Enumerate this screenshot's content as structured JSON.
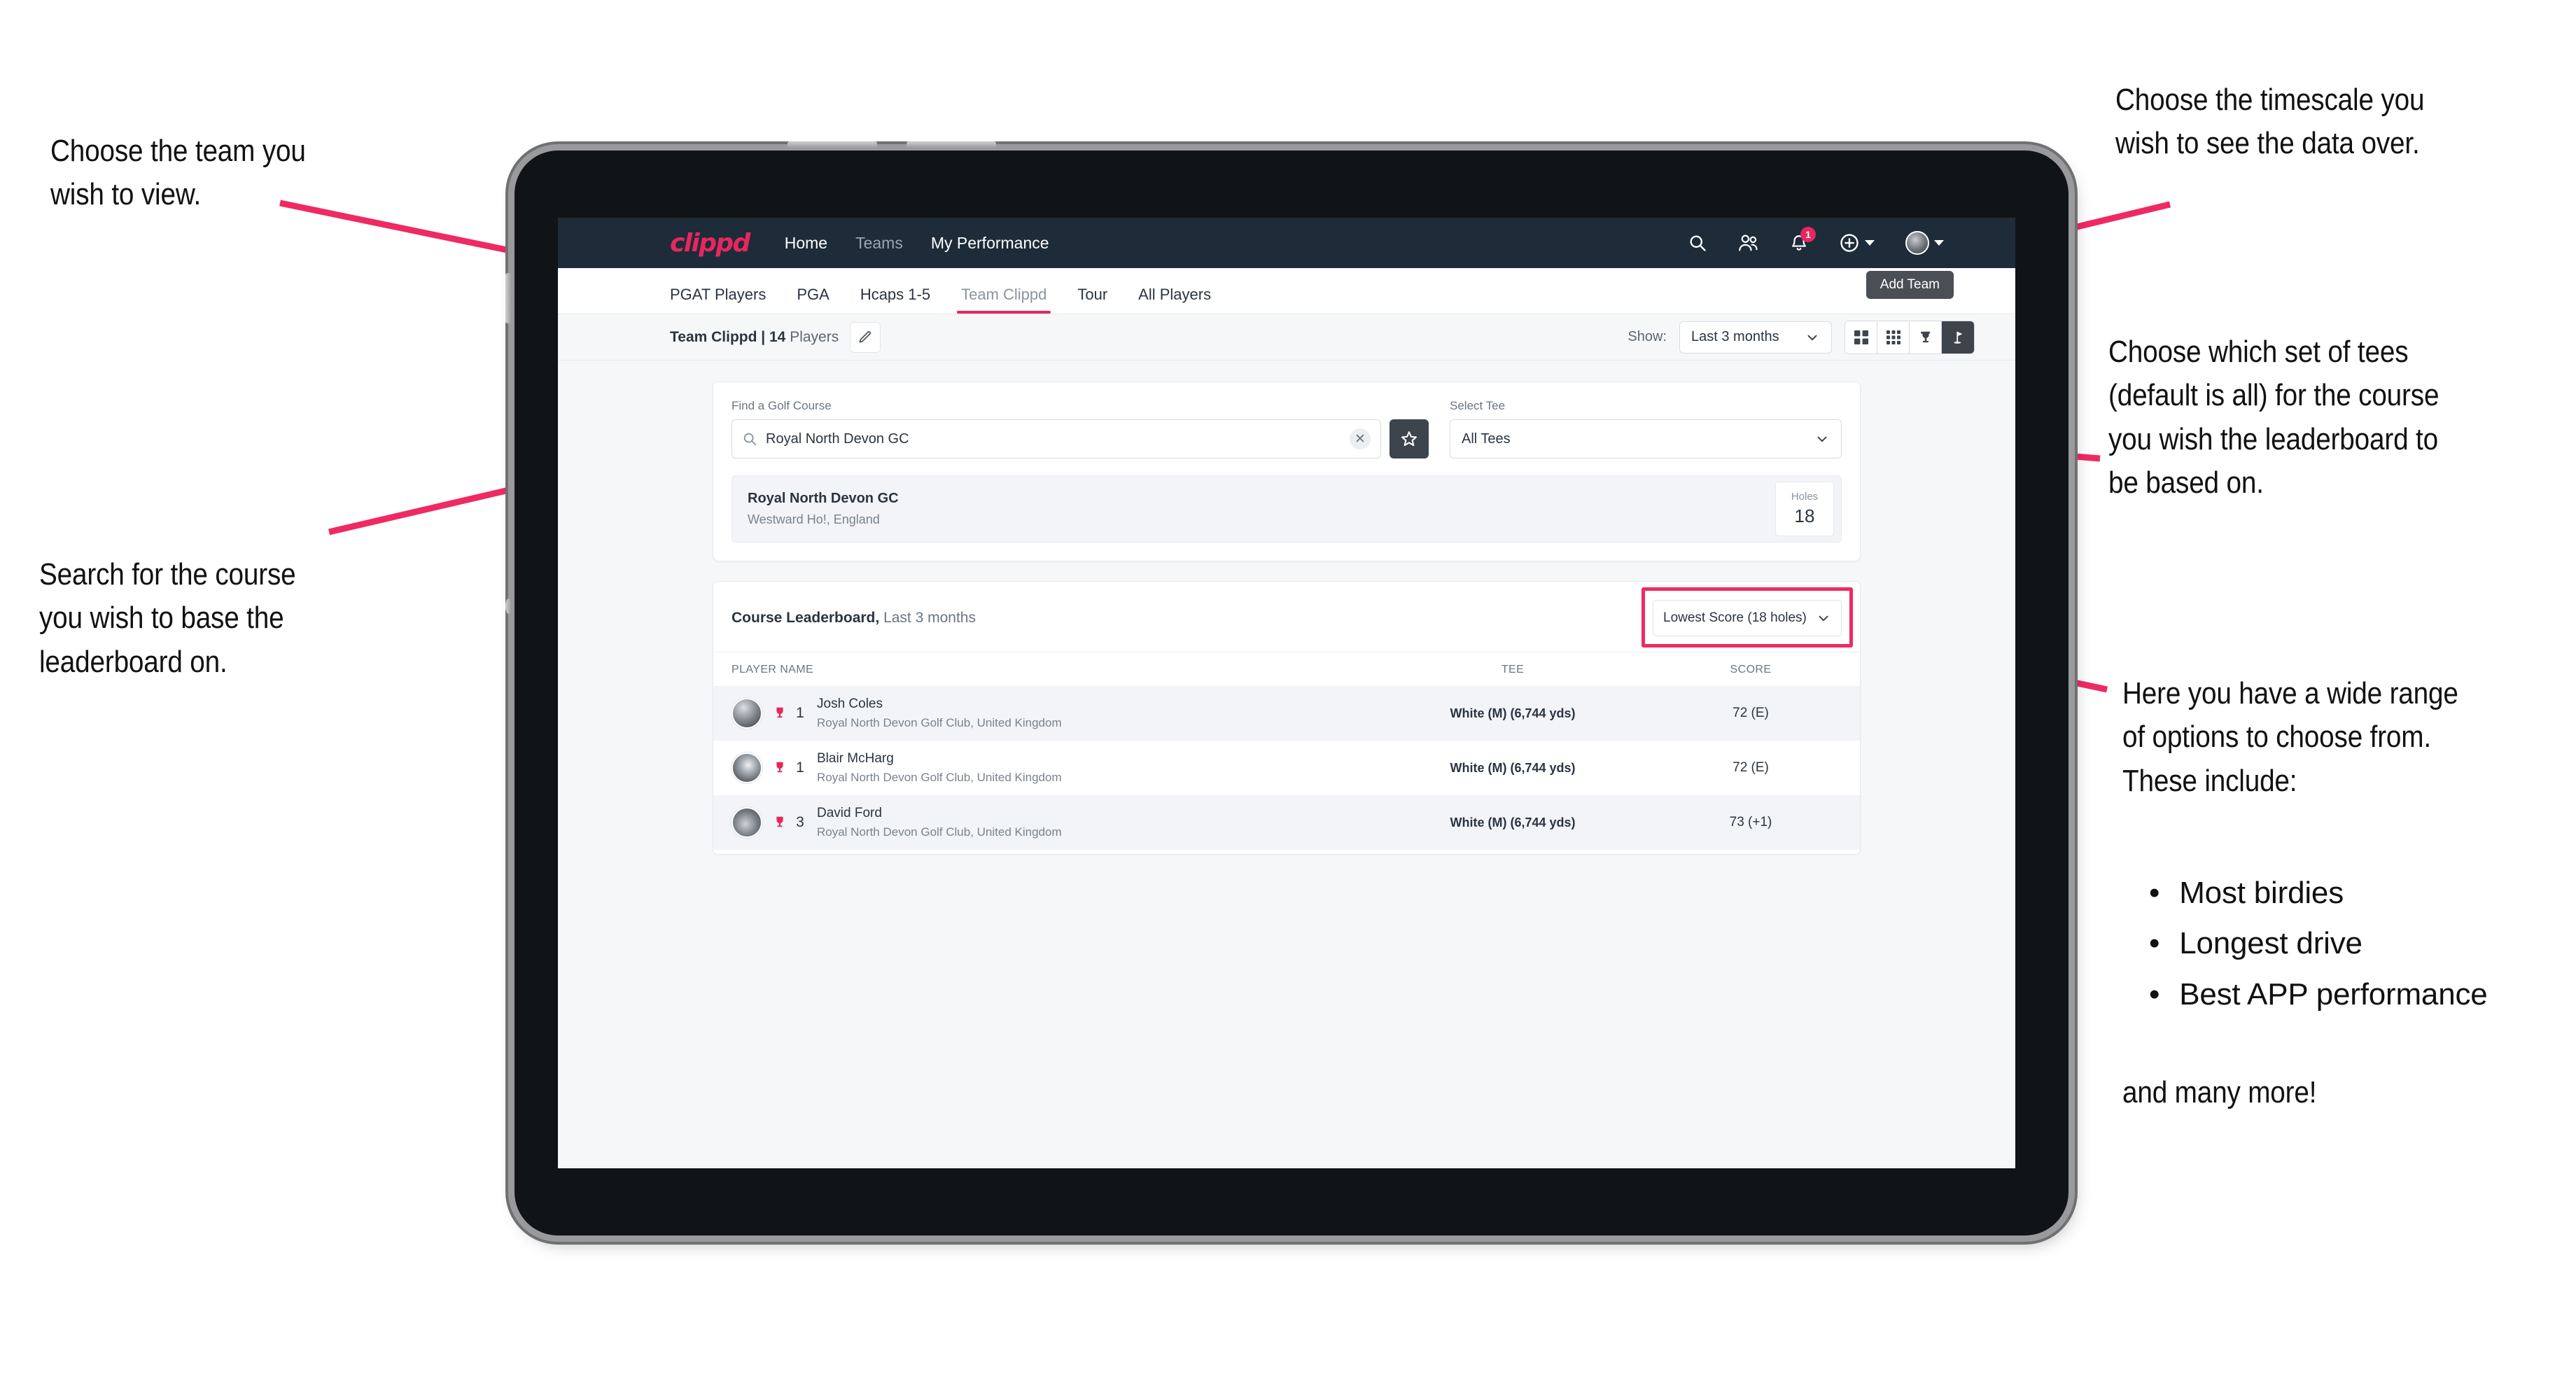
{
  "annotations": {
    "top_left": "Choose the team you\nwish to view.",
    "mid_left": "Search for the course\nyou wish to base the\nleaderboard on.",
    "top_right": "Choose the timescale you\nwish to see the data over.",
    "mid_right": "Choose which set of tees\n(default is all) for the course\nyou wish the leaderboard to\nbe based on.",
    "bottom_right_intro": "Here you have a wide range\nof options to choose from.\nThese include:",
    "bottom_right_bullets": [
      "Most birdies",
      "Longest drive",
      "Best APP performance"
    ],
    "bottom_right_outro": "and many more!"
  },
  "navbar": {
    "brand": "clippd",
    "links": [
      {
        "label": "Home",
        "dim": false
      },
      {
        "label": "Teams",
        "dim": true
      },
      {
        "label": "My Performance",
        "dim": false
      }
    ],
    "icons": [
      "search-icon",
      "people-icon",
      "bell-icon",
      "plus-circle-icon",
      "avatar-icon"
    ],
    "notification_count": "1"
  },
  "tooltip": {
    "label": "Add Team"
  },
  "tabs": [
    {
      "label": "PGAT Players",
      "active": false,
      "dim": false
    },
    {
      "label": "PGA",
      "active": false,
      "dim": false
    },
    {
      "label": "Hcaps 1-5",
      "active": false,
      "dim": false
    },
    {
      "label": "Team Clippd",
      "active": true,
      "dim": true
    },
    {
      "label": "Tour",
      "active": false,
      "dim": false
    },
    {
      "label": "All Players",
      "active": false,
      "dim": false
    }
  ],
  "subbar": {
    "team_name": "Team Clippd",
    "separator": " | ",
    "player_count": "14",
    "players_word": " Players",
    "edit_icon": "pencil-icon",
    "show_label": "Show:",
    "timescale_value": "Last 3 months",
    "view_buttons": [
      "grid-2x2-icon",
      "grid-3x3-icon",
      "trophy-icon",
      "golf-flag-icon"
    ]
  },
  "search": {
    "course_label": "Find a Golf Course",
    "course_value": "Royal North Devon GC",
    "course_placeholder": "Find a Golf Course",
    "clear_icon": "close-icon",
    "favourite_icon": "star-icon",
    "tee_label": "Select Tee",
    "tee_value": "All Tees"
  },
  "course_result": {
    "name": "Royal North Devon GC",
    "location": "Westward Ho!, England",
    "holes_label": "Holes",
    "holes_value": "18"
  },
  "leaderboard": {
    "title": "Course Leaderboard,",
    "subtitle": " Last 3 months",
    "sort_value": "Lowest Score (18 holes)",
    "columns": [
      "PLAYER NAME",
      "TEE",
      "SCORE"
    ],
    "rows": [
      {
        "rank": "1",
        "name": "Josh Coles",
        "club": "Royal North Devon Golf Club, United Kingdom",
        "tee": "White (M) (6,744 yds)",
        "score": "72 (E)",
        "medal": "trophy-icon"
      },
      {
        "rank": "1",
        "name": "Blair McHarg",
        "club": "Royal North Devon Golf Club, United Kingdom",
        "tee": "White (M) (6,744 yds)",
        "score": "72 (E)",
        "medal": "trophy-icon"
      },
      {
        "rank": "3",
        "name": "David Ford",
        "club": "Royal North Devon Golf Club, United Kingdom",
        "tee": "White (M) (6,744 yds)",
        "score": "73 (+1)",
        "medal": "trophy-icon"
      }
    ]
  },
  "colors": {
    "accent_pink": "#e6275f",
    "annotation_arrow": "#ef2a63",
    "navbar_bg": "#1e2b38",
    "highlight_border": "#ef2a63"
  }
}
